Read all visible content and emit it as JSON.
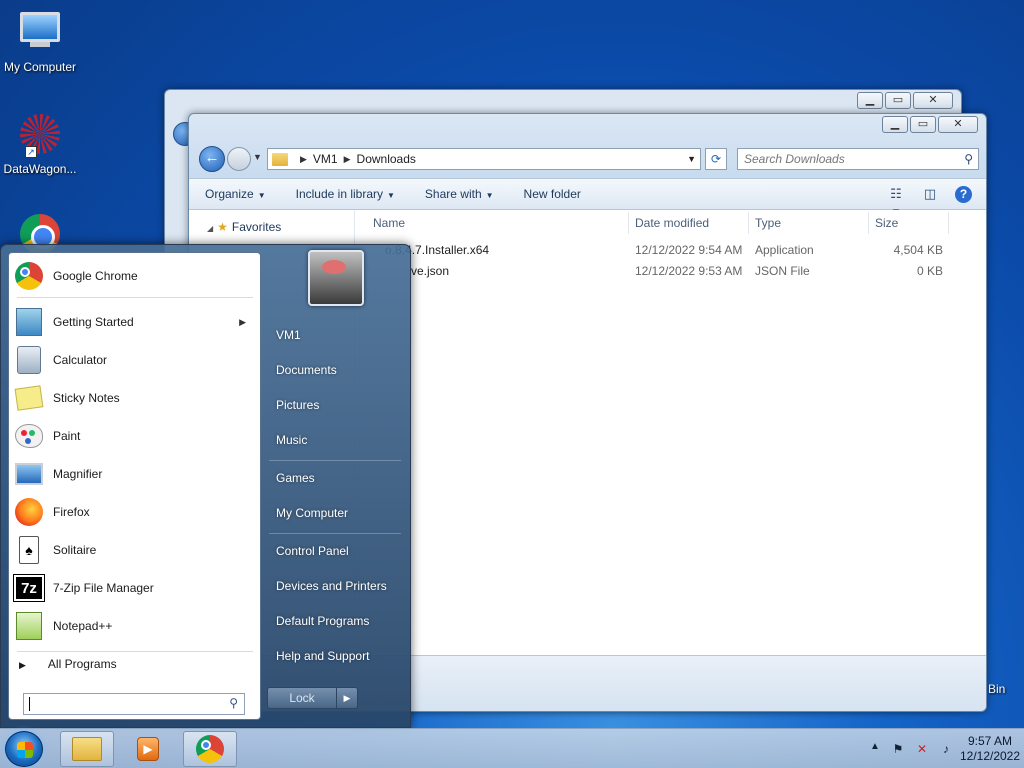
{
  "desktop": {
    "icons": [
      {
        "label": "My Computer"
      },
      {
        "label": "DataWagon..."
      }
    ],
    "recycle_bin_label": "Bin"
  },
  "explorer": {
    "breadcrumb": [
      "VM1",
      "Downloads"
    ],
    "search_placeholder": "Search Downloads",
    "toolbar": {
      "organize": "Organize",
      "include": "Include in library",
      "share": "Share with",
      "new_folder": "New folder"
    },
    "nav": {
      "favorites": "Favorites"
    },
    "columns": {
      "name": "Name",
      "date": "Date modified",
      "type": "Type",
      "size": "Size"
    },
    "files": [
      {
        "name": "o.8.4.7.Installer.x64",
        "date": "12/12/2022 9:54 AM",
        "type": "Application",
        "size": "4,504 KB"
      },
      {
        "name": "ve.json",
        "date": "12/12/2022 9:53 AM",
        "type": "JSON File",
        "size": "0 KB"
      }
    ]
  },
  "start_menu": {
    "programs": [
      {
        "label": "Google Chrome",
        "icon": "chrome-icon"
      },
      {
        "label": "Getting Started",
        "icon": "getting-started-icon"
      },
      {
        "label": "Calculator",
        "icon": "calculator-icon"
      },
      {
        "label": "Sticky Notes",
        "icon": "sticky-notes-icon"
      },
      {
        "label": "Paint",
        "icon": "paint-icon"
      },
      {
        "label": "Magnifier",
        "icon": "magnifier-icon"
      },
      {
        "label": "Firefox",
        "icon": "firefox-icon"
      },
      {
        "label": "Solitaire",
        "icon": "solitaire-icon"
      },
      {
        "label": "7-Zip File Manager",
        "icon": "7zip-icon"
      },
      {
        "label": "Notepad++",
        "icon": "notepadpp-icon"
      }
    ],
    "seven_zip_glyph": "7z",
    "all_programs": "All Programs",
    "search_value": "",
    "right": {
      "user": "VM1",
      "documents": "Documents",
      "pictures": "Pictures",
      "music": "Music",
      "games": "Games",
      "my_computer": "My Computer",
      "control_panel": "Control Panel",
      "devices": "Devices and Printers",
      "default_programs": "Default Programs",
      "help": "Help and Support"
    },
    "lock": "Lock"
  },
  "taskbar": {
    "clock_time": "9:57 AM",
    "clock_date": "12/12/2022"
  }
}
